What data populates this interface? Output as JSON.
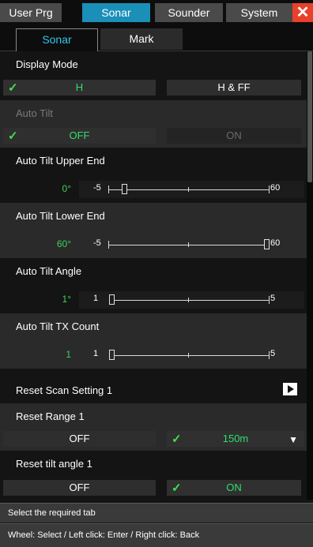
{
  "top_tabs": [
    {
      "label": "User Prg",
      "active": false
    },
    {
      "label": "Sonar",
      "active": true
    },
    {
      "label": "Sounder",
      "active": false
    },
    {
      "label": "System",
      "active": false
    }
  ],
  "close_symbol": "✕",
  "sub_tabs": [
    {
      "label": "Sonar",
      "active": true
    },
    {
      "label": "Mark",
      "active": false
    }
  ],
  "check_symbol": "✓",
  "display_mode": {
    "title": "Display Mode",
    "options": [
      "H",
      "H & FF"
    ],
    "selected": "H"
  },
  "auto_tilt": {
    "title": "Auto Tilt",
    "options": [
      "OFF",
      "ON"
    ],
    "selected": "OFF",
    "enabled": false
  },
  "upper_end": {
    "title": "Auto Tilt Upper End",
    "value": "0°",
    "min": "-5",
    "max": "60",
    "position": 0.0
  },
  "lower_end": {
    "title": "Auto Tilt Lower End",
    "value": "60°",
    "min": "-5",
    "max": "60",
    "position": 1.0
  },
  "tilt_angle": {
    "title": "Auto Tilt Angle",
    "value": "1°",
    "min": "1",
    "max": "5",
    "position": 0.0
  },
  "tx_count": {
    "title": "Auto Tilt TX Count",
    "value": "1",
    "min": "1",
    "max": "5",
    "position": 0.0
  },
  "reset_scan": {
    "title": "Reset Scan Setting 1"
  },
  "reset_range": {
    "title": "Reset Range 1",
    "off_label": "OFF",
    "value": "150m",
    "selected": "150m"
  },
  "reset_tilt": {
    "title": "Reset tilt angle 1",
    "options": [
      "OFF",
      "ON"
    ],
    "selected": "ON"
  },
  "dropdown_symbol": "▼",
  "status": {
    "line1": "Select the required tab",
    "line2": "Wheel: Select / Left click: Enter / Right click: Back"
  },
  "colors": {
    "accent": "#1a8fb8",
    "selected_text": "#2ee06a",
    "value_text": "#3ed05a",
    "close": "#e8402a"
  }
}
